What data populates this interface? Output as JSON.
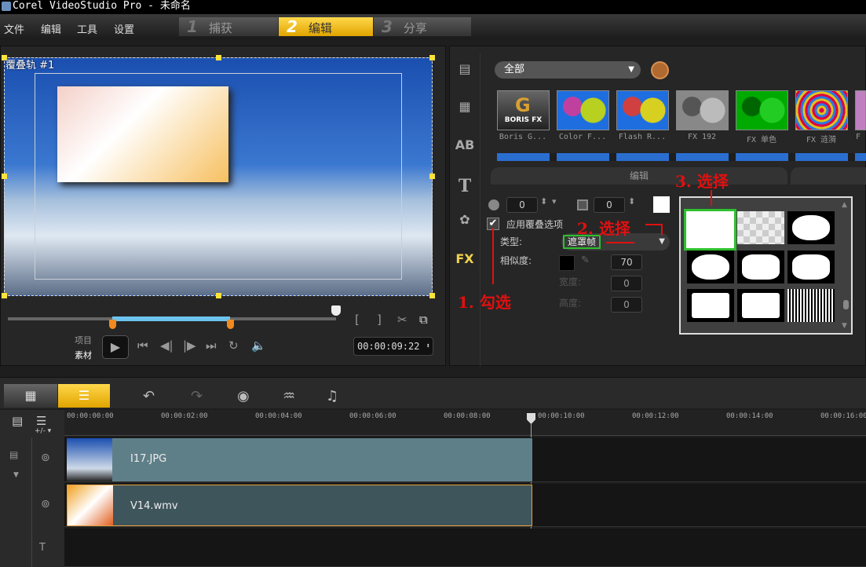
{
  "window": {
    "title": "Corel VideoStudio Pro - 未命名"
  },
  "menu": [
    "文件",
    "编辑",
    "工具",
    "设置"
  ],
  "steps": [
    {
      "num": "1",
      "label": "捕获"
    },
    {
      "num": "2",
      "label": "编辑",
      "active": true
    },
    {
      "num": "3",
      "label": "分享"
    }
  ],
  "preview": {
    "overlay_label": "覆叠轨 #1",
    "project_label": "项目",
    "clip_label": "素材",
    "timecode": "00:00:09:22"
  },
  "library": {
    "category": "全部",
    "thumbs": [
      "Boris G...",
      "Color F...",
      "Flash R...",
      "FX 192",
      "FX 单色",
      "FX 涟漪",
      "F"
    ],
    "boris_text": "BORIS FX"
  },
  "options": {
    "tab": "编辑",
    "spin1": "0",
    "spin2": "0",
    "apply_overlay": "应用覆叠选项",
    "apply_checked": true,
    "type_label": "类型:",
    "type_value": "遮罩帧",
    "similarity_label": "相似度:",
    "similarity": "70",
    "width_label": "宽度:",
    "width": "0",
    "height_label": "高度:",
    "height": "0",
    "fx_icon": "FX"
  },
  "annotations": {
    "a1": "1. 勾选",
    "a2": "2. 选择",
    "a3": "3. 选择"
  },
  "timeline": {
    "ticks": [
      "00:00:00:00",
      "00:00:02:00",
      "00:00:04:00",
      "00:00:06:00",
      "00:00:08:00",
      "00:00:10:00",
      "00:00:12:00",
      "00:00:14:00",
      "00:00:16:00"
    ],
    "zoom_label": "+/- ▾",
    "clips": [
      {
        "name": "I17.JPG"
      },
      {
        "name": "V14.wmv"
      }
    ]
  },
  "colors": {
    "accent": "#f0b400",
    "selection": "#2ec02e",
    "annotation": "#e01010"
  }
}
